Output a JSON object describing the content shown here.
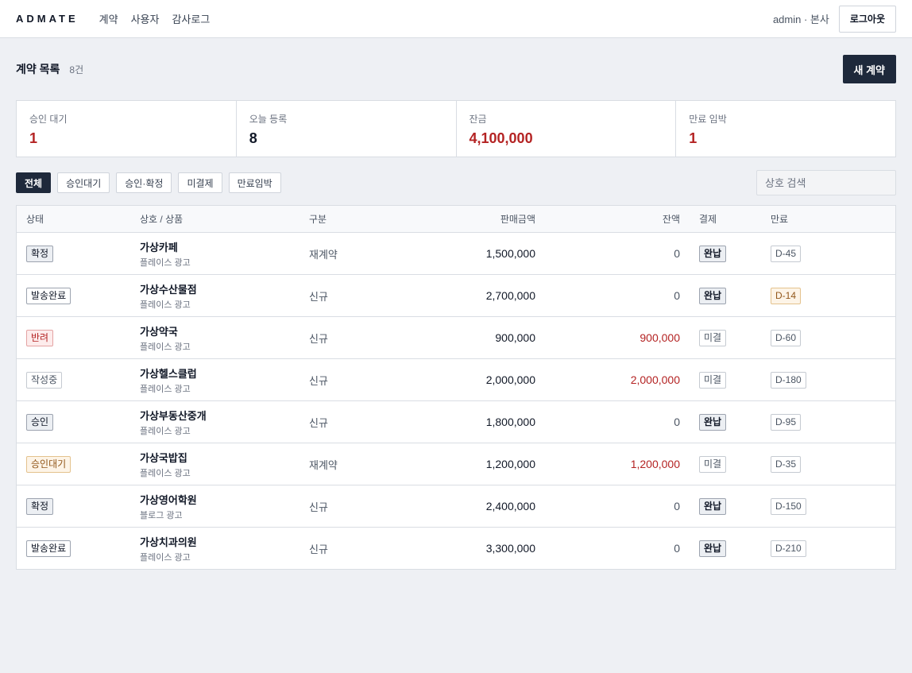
{
  "header": {
    "brand": "ADMATE",
    "nav": [
      "계약",
      "사용자",
      "감사로그"
    ],
    "user": "admin · 본사",
    "logout": "로그아웃"
  },
  "page": {
    "title": "계약 목록",
    "count": "8건",
    "new_button": "새 계약"
  },
  "stats": [
    {
      "label": "승인 대기",
      "value": "1",
      "tone": "red"
    },
    {
      "label": "오늘 등록",
      "value": "8",
      "tone": "dark"
    },
    {
      "label": "잔금",
      "value": "4,100,000",
      "tone": "red"
    },
    {
      "label": "만료 임박",
      "value": "1",
      "tone": "red"
    }
  ],
  "filters": [
    "전체",
    "승인대기",
    "승인·확정",
    "미결제",
    "만료임박"
  ],
  "active_filter": 0,
  "search": {
    "placeholder": "상호 검색"
  },
  "table": {
    "columns": [
      "상태",
      "상호 / 상품",
      "구분",
      "판매금액",
      "잔액",
      "결제",
      "만료"
    ],
    "rows": [
      {
        "status": "확정",
        "status_style": "gray",
        "name": "가상카페",
        "product": "플레이스 광고",
        "type": "재계약",
        "amount": "1,500,000",
        "balance": "0",
        "balance_due": false,
        "payment": "완납",
        "paid": true,
        "expiry": "D-45",
        "expiry_warn": false
      },
      {
        "status": "발송완료",
        "status_style": "white",
        "name": "가상수산물점",
        "product": "플레이스 광고",
        "type": "신규",
        "amount": "2,700,000",
        "balance": "0",
        "balance_due": false,
        "payment": "완납",
        "paid": true,
        "expiry": "D-14",
        "expiry_warn": true
      },
      {
        "status": "반려",
        "status_style": "red",
        "name": "가상약국",
        "product": "플레이스 광고",
        "type": "신규",
        "amount": "900,000",
        "balance": "900,000",
        "balance_due": true,
        "payment": "미결",
        "paid": false,
        "expiry": "D-60",
        "expiry_warn": false
      },
      {
        "status": "작성중",
        "status_style": "light",
        "name": "가상헬스클럽",
        "product": "플레이스 광고",
        "type": "신규",
        "amount": "2,000,000",
        "balance": "2,000,000",
        "balance_due": true,
        "payment": "미결",
        "paid": false,
        "expiry": "D-180",
        "expiry_warn": false
      },
      {
        "status": "승인",
        "status_style": "gray",
        "name": "가상부동산중개",
        "product": "플레이스 광고",
        "type": "신규",
        "amount": "1,800,000",
        "balance": "0",
        "balance_due": false,
        "payment": "완납",
        "paid": true,
        "expiry": "D-95",
        "expiry_warn": false
      },
      {
        "status": "승인대기",
        "status_style": "amber",
        "name": "가상국밥집",
        "product": "플레이스 광고",
        "type": "재계약",
        "amount": "1,200,000",
        "balance": "1,200,000",
        "balance_due": true,
        "payment": "미결",
        "paid": false,
        "expiry": "D-35",
        "expiry_warn": false
      },
      {
        "status": "확정",
        "status_style": "gray",
        "name": "가상영어학원",
        "product": "블로그 광고",
        "type": "신규",
        "amount": "2,400,000",
        "balance": "0",
        "balance_due": false,
        "payment": "완납",
        "paid": true,
        "expiry": "D-150",
        "expiry_warn": false
      },
      {
        "status": "발송완료",
        "status_style": "white",
        "name": "가상치과의원",
        "product": "플레이스 광고",
        "type": "신규",
        "amount": "3,300,000",
        "balance": "0",
        "balance_due": false,
        "payment": "완납",
        "paid": true,
        "expiry": "D-210",
        "expiry_warn": false
      }
    ]
  },
  "colors": {
    "primary": "#1e293b",
    "danger": "#b42323",
    "warning": "#92571a"
  }
}
